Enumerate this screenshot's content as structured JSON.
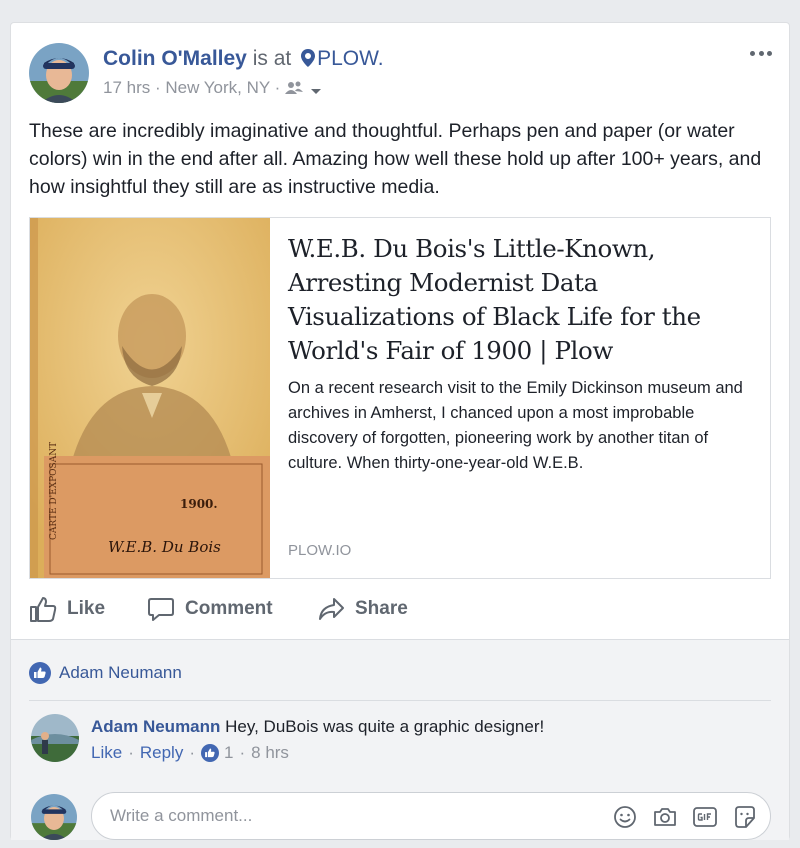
{
  "post": {
    "author": "Colin O'Malley",
    "is_at": "is at",
    "place": "PLOW.",
    "time": "17 hrs",
    "dot1": " · ",
    "location": "New York, NY",
    "dot2": " · ",
    "text": "These are incredibly imaginative and thoughtful. Perhaps pen and paper (or water colors) win in the end after all. Amazing how well these hold up after 100+ years, and how insightful they still are as instructive media."
  },
  "link": {
    "title": "W.E.B. Du Bois's Little-Known, Arresting Modernist Data Visualizations of Black Life for the World's Fair of 1900 | Plow",
    "description": "On a recent research visit to the Emily Dickinson museum and archives in Amherst, I chanced upon a most improbable discovery of forgotten, pioneering work by another titan of culture. When thirty-one-year-old W.E.B.",
    "domain": "PLOW.IO",
    "thumb_caption_year": "1900.",
    "thumb_caption_left": "CARTE D'EXPOSANT",
    "thumb_signature": "W.E.B. Du Bois"
  },
  "actions": {
    "like": "Like",
    "comment": "Comment",
    "share": "Share"
  },
  "reactions": {
    "names": "Adam Neumann"
  },
  "comment": {
    "author": "Adam Neumann",
    "text": " Hey, DuBois was quite a graphic designer!",
    "like": "Like",
    "reply": "Reply",
    "sep": "·",
    "like_count": "1",
    "time": "8 hrs"
  },
  "composer": {
    "placeholder": "Write a comment..."
  },
  "icons": {
    "more": "more-options-icon",
    "place": "map-pin-icon",
    "audience": "friends-audience-icon",
    "like": "thumbs-up-icon",
    "comment": "speech-bubble-icon",
    "share": "share-arrow-icon",
    "emoji": "smiley-icon",
    "camera": "camera-icon",
    "gif": "gif-icon",
    "sticker": "sticker-icon"
  },
  "colors": {
    "link_blue": "#385898",
    "like_blue": "#4267b2",
    "meta_gray": "#90949c",
    "action_gray": "#606770",
    "sepia": "#e8c577"
  }
}
